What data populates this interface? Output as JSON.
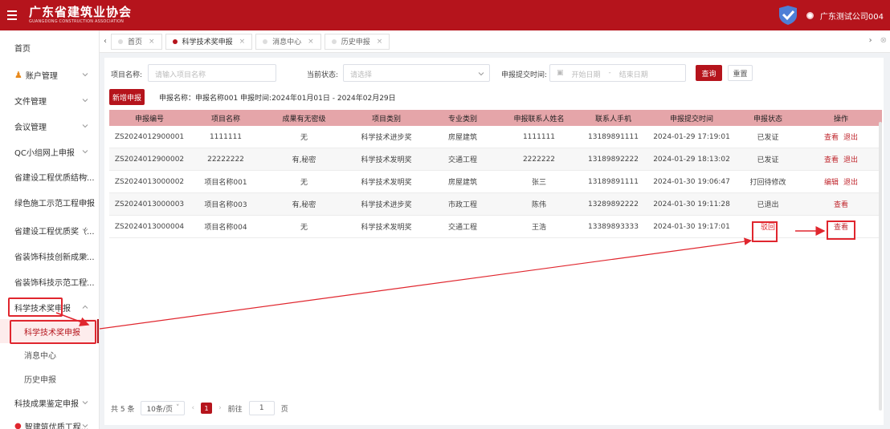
{
  "header": {
    "title": "广东省建筑业协会",
    "subtitle": "GUANGDONG CONSTRUCTION ASSOCIATION",
    "user": "广东测试公司004"
  },
  "sidebar": {
    "items": [
      {
        "label": "首页"
      },
      {
        "label": "账户管理"
      },
      {
        "label": "文件管理"
      },
      {
        "label": "会议管理"
      },
      {
        "label": "QC小组网上申报"
      },
      {
        "label": "省建设工程优质结构..."
      },
      {
        "label": "绿色施工示范工程申报"
      },
      {
        "label": "省建设工程优质奖（..."
      },
      {
        "label": "省装饰科技创新成果..."
      },
      {
        "label": "省装饰科技示范工程..."
      },
      {
        "label": "科学技术奖申报"
      },
      {
        "label": "科学技术奖申报"
      },
      {
        "label": "消息中心"
      },
      {
        "label": "历史申报"
      },
      {
        "label": "科技成果鉴定申报"
      },
      {
        "label": "智建筑优质工程..."
      }
    ]
  },
  "tabs": [
    {
      "label": "首页"
    },
    {
      "label": "科学技术奖申报"
    },
    {
      "label": "消息中心"
    },
    {
      "label": "历史申报"
    }
  ],
  "filter": {
    "project_name_label": "项目名称:",
    "project_name_placeholder": "请输入项目名称",
    "status_label": "当前状态:",
    "status_placeholder": "请选择",
    "submit_time_label": "申报提交时间:",
    "start_date": "开始日期",
    "date_sep": "-",
    "end_date": "结束日期",
    "query_label": "查询",
    "reset_label": "重置"
  },
  "toolbar": {
    "new_label": "新增申报",
    "info": "申报名称：申报名称001 申报时间:2024年01月01日 - 2024年02月29日"
  },
  "table": {
    "headers": [
      "申报编号",
      "项目名称",
      "成果有无密级",
      "项目类别",
      "专业类别",
      "申报联系人姓名",
      "联系人手机",
      "申报提交时间",
      "申报状态",
      "操作"
    ],
    "rows": [
      {
        "cells": [
          "ZS2024012900001",
          "1111111",
          "无",
          "科学技术进步奖",
          "房屋建筑",
          "1111111",
          "13189891111",
          "2024-01-29 17:19:01",
          "已发证"
        ],
        "ops": [
          "查看",
          "退出"
        ]
      },
      {
        "cells": [
          "ZS2024012900002",
          "22222222",
          "有,秘密",
          "科学技术发明奖",
          "交通工程",
          "2222222",
          "13189892222",
          "2024-01-29 18:13:02",
          "已发证"
        ],
        "ops": [
          "查看",
          "退出"
        ]
      },
      {
        "cells": [
          "ZS2024013000002",
          "项目名称001",
          "无",
          "科学技术发明奖",
          "房屋建筑",
          "张三",
          "13189891111",
          "2024-01-30 19:06:47",
          "打回待修改"
        ],
        "ops": [
          "编辑",
          "退出"
        ]
      },
      {
        "cells": [
          "ZS2024013000003",
          "项目名称003",
          "有,秘密",
          "科学技术进步奖",
          "市政工程",
          "陈伟",
          "13289892222",
          "2024-01-30 19:11:28",
          "已退出"
        ],
        "ops": [
          "查看"
        ]
      },
      {
        "cells": [
          "ZS2024013000004",
          "项目名称004",
          "无",
          "科学技术发明奖",
          "交通工程",
          "王浩",
          "13389893333",
          "2024-01-30 19:17:01",
          "驳回"
        ],
        "ops": [
          "查看"
        ]
      }
    ]
  },
  "pagination": {
    "total": "共 5 条",
    "page_size": "10条/页",
    "current": "1",
    "goto_label": "前往",
    "goto_value": "1",
    "page_suffix": "页"
  },
  "colors": {
    "brand": "#b5141c",
    "header_row": "#e5a5a9",
    "annotation": "#e0262e"
  }
}
